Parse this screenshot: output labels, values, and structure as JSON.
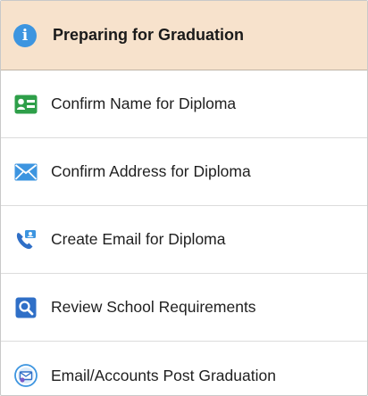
{
  "header": {
    "icon": "info-icon",
    "icon_glyph": "i",
    "title": "Preparing for Graduation",
    "background": "#f7e2cc"
  },
  "items": [
    {
      "label": "Confirm Name for Diploma",
      "icon": "name-card-icon"
    },
    {
      "label": "Confirm Address for Diploma",
      "icon": "envelope-icon"
    },
    {
      "label": "Create Email for Diploma",
      "icon": "phone-contact-icon"
    },
    {
      "label": "Review School Requirements",
      "icon": "search-icon"
    },
    {
      "label": "Email/Accounts Post Graduation",
      "icon": "email-accounts-icon"
    }
  ],
  "colors": {
    "accent_blue": "#3d95e0",
    "green": "#2e9f49"
  }
}
